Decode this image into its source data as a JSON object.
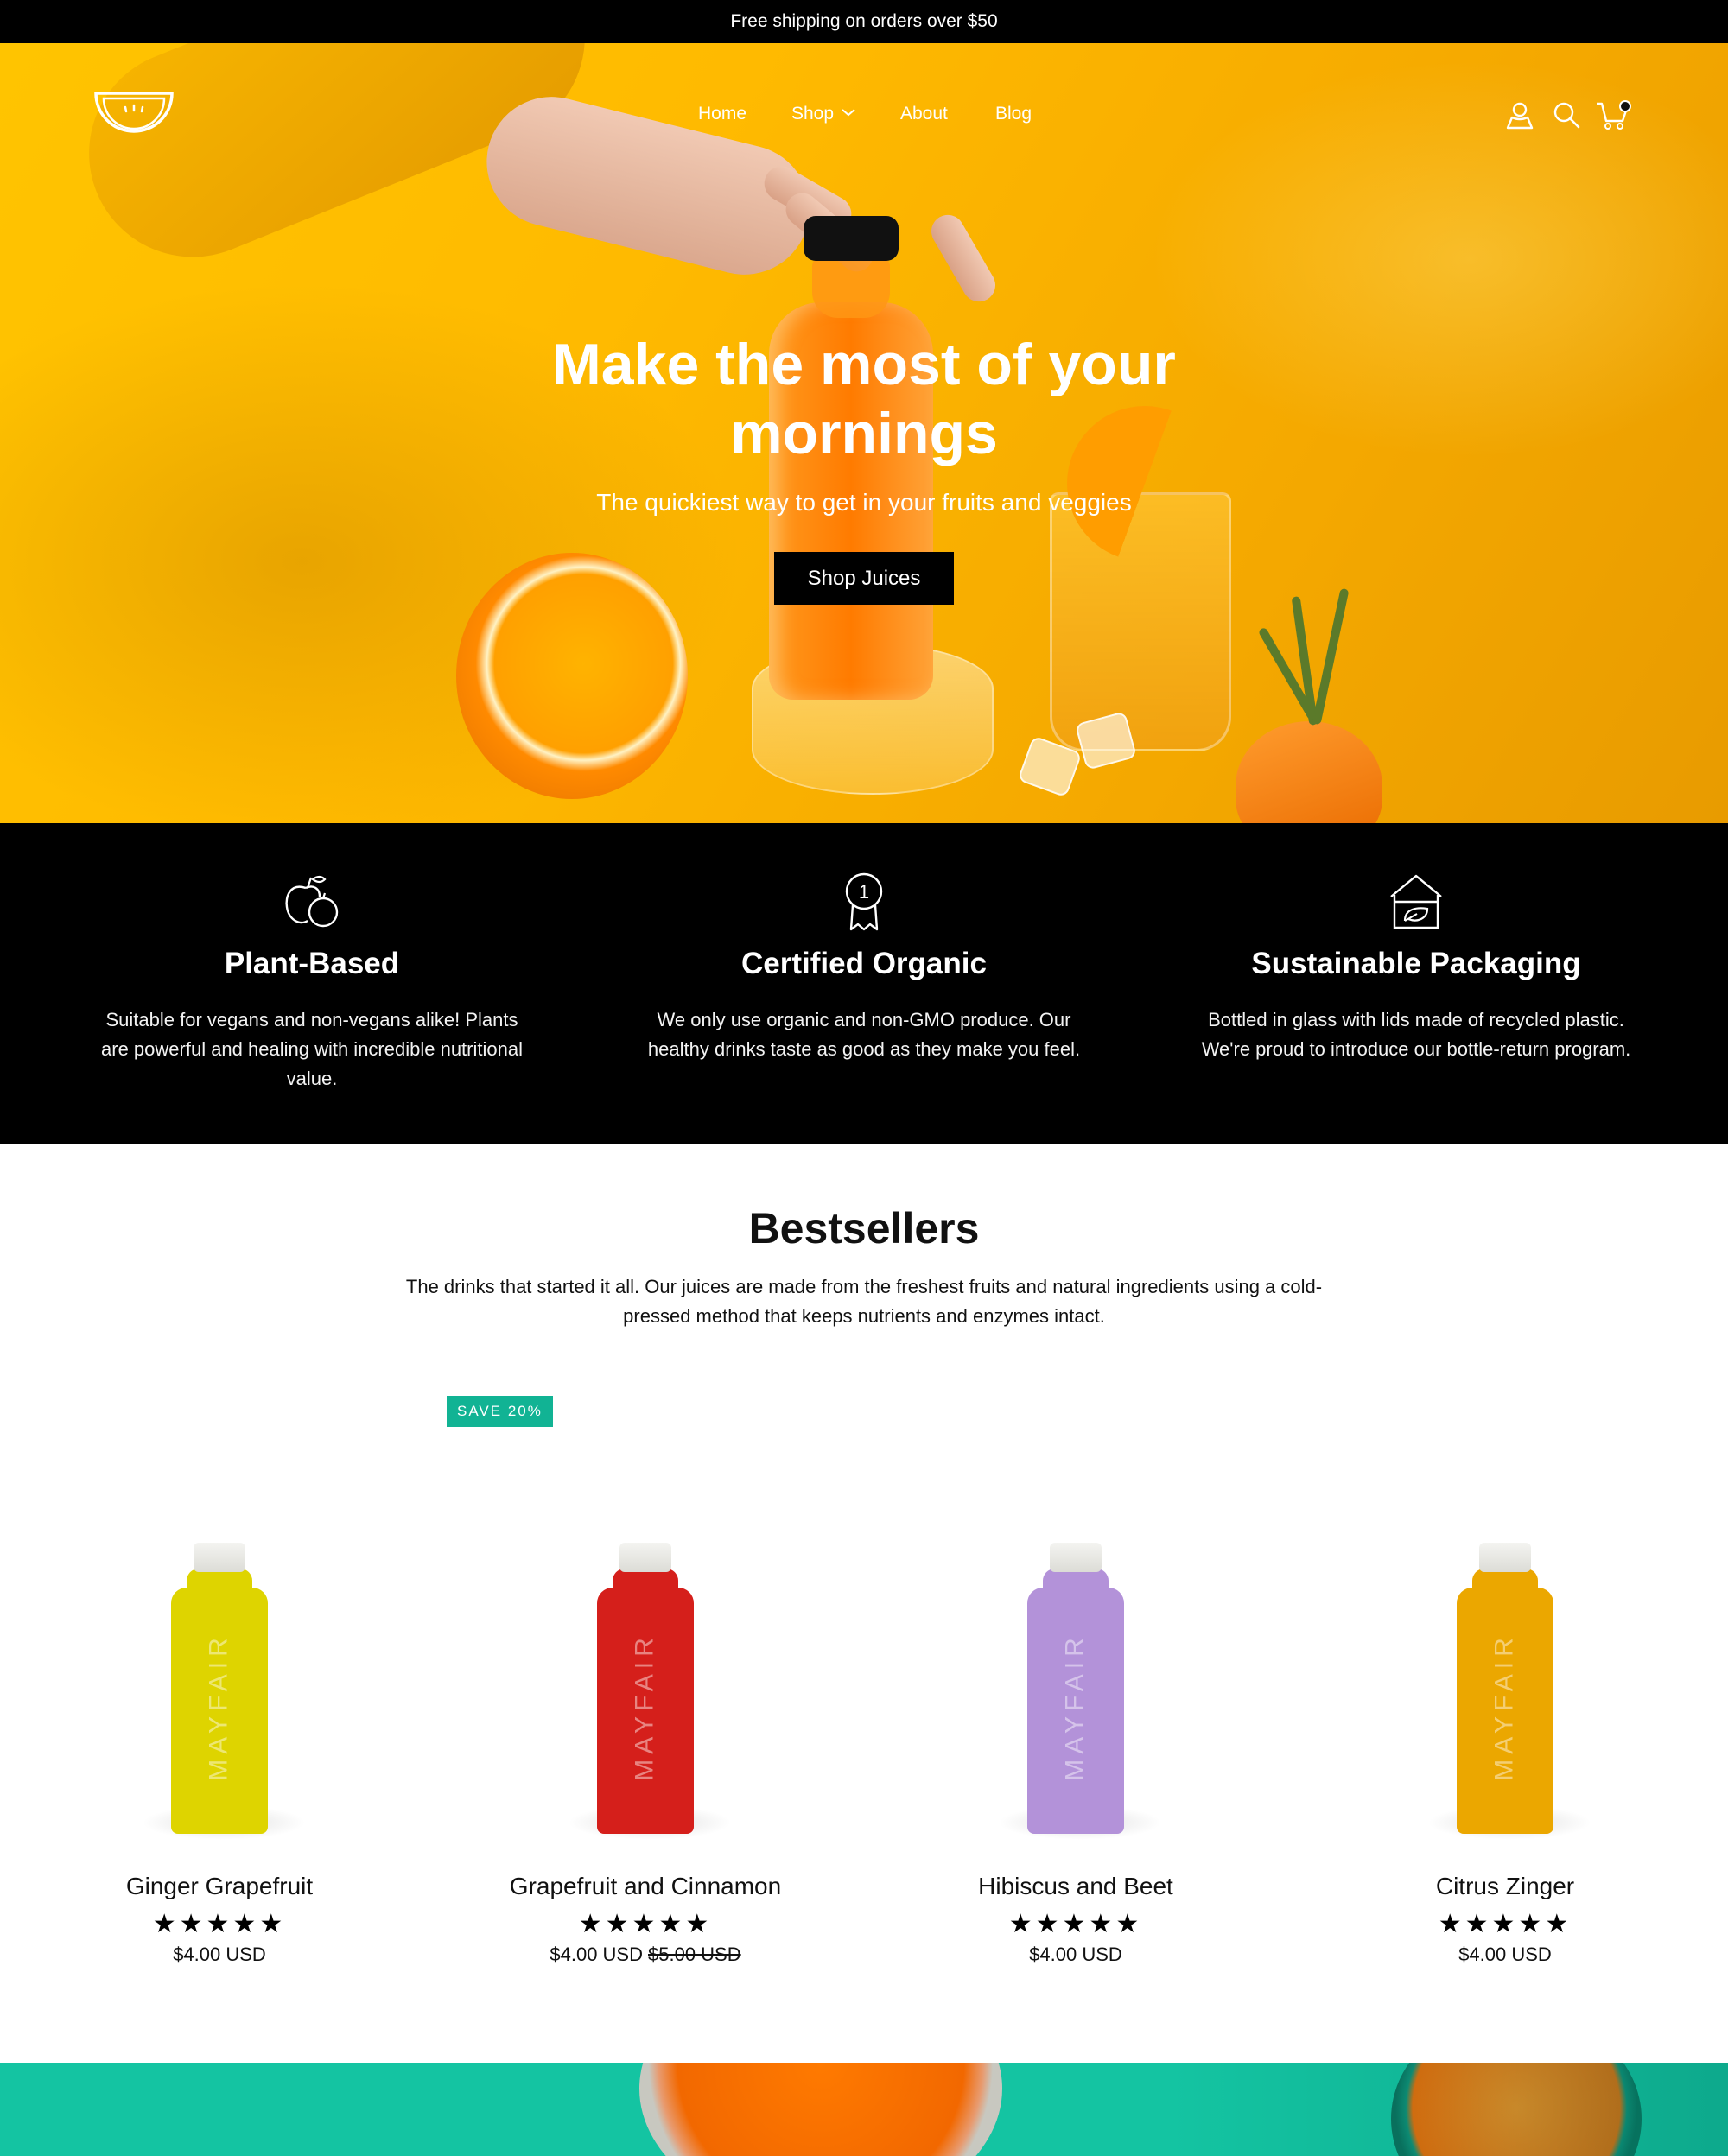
{
  "announcement": "Free shipping on orders over $50",
  "header": {
    "nav": [
      "Home",
      "Shop",
      "About",
      "Blog"
    ],
    "icons": [
      "account-icon",
      "search-icon",
      "cart-icon"
    ]
  },
  "hero": {
    "title": "Make the most of your mornings",
    "subtitle": "The quickiest way to get in your fruits and veggies",
    "button": "Shop Juices"
  },
  "features": [
    {
      "icon": "fruit-icon",
      "title": "Plant-Based",
      "text": "Suitable for vegans and non-vegans alike! Plants are powerful and healing with incredible nutritional value."
    },
    {
      "icon": "award-ribbon-icon",
      "title": "Certified Organic",
      "text": "We only use organic and non-GMO produce. Our healthy drinks taste as good as they make you feel."
    },
    {
      "icon": "eco-house-icon",
      "title": "Sustainable Packaging",
      "text": "Bottled in glass with lids made of recycled plastic. We're proud to introduce our bottle-return program."
    }
  ],
  "bestsellers": {
    "title": "Bestsellers",
    "subtitle": "The drinks that started it all. Our juices are made from the freshest fruits and natural ingredients using a cold-pressed method that keeps nutrients and enzymes intact.",
    "products": [
      {
        "name": "Ginger Grapefruit",
        "rating": "★★★★★",
        "price": "$4.00 USD",
        "compare_price": "",
        "badge": "",
        "color": "#e3d800",
        "label": "MAYFAIR"
      },
      {
        "name": "Grapefruit and Cinnamon",
        "rating": "★★★★★",
        "price": "$4.00 USD",
        "compare_price": "$5.00 USD",
        "badge": "SAVE 20%",
        "color": "#d9201c",
        "label": "MAYFAIR"
      },
      {
        "name": "Hibiscus and Beet",
        "rating": "★★★★★",
        "price": "$4.00 USD",
        "compare_price": "",
        "badge": "",
        "color": "#b795dd",
        "label": "MAYFAIR"
      },
      {
        "name": "Citrus Zinger",
        "rating": "★★★★★",
        "price": "$4.00 USD",
        "compare_price": "",
        "badge": "",
        "color": "#f0aa00",
        "label": "MAYFAIR"
      }
    ]
  },
  "colors": {
    "accent_teal": "#14c4a2",
    "badge": "#11b394",
    "hero_yellow": "#ffba00",
    "black": "#000000"
  }
}
